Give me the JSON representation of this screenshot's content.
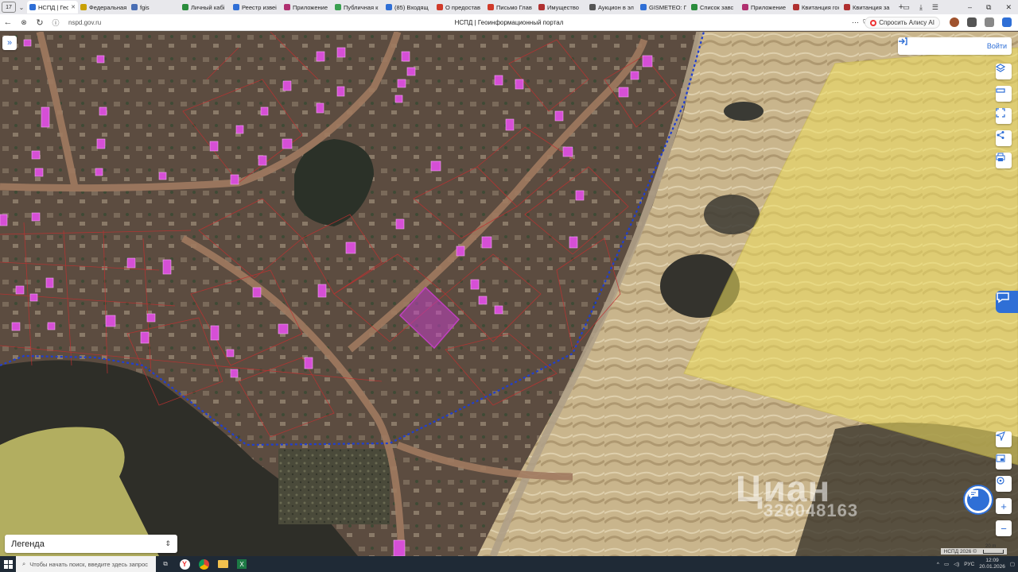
{
  "browser": {
    "tab_count": "17",
    "tabs": [
      {
        "title": "НСПД | Гео",
        "color": "#2f6fd6",
        "active": true
      },
      {
        "title": "Федеральная",
        "color": "#c9a000"
      },
      {
        "title": "fgis",
        "color": "#4a6fb5"
      },
      {
        "title": "Личный кабі",
        "color": "#2a8c3c"
      },
      {
        "title": "Реестр извеі",
        "color": "#2f6fd6"
      },
      {
        "title": "Приложение",
        "color": "#b03070"
      },
      {
        "title": "Публичная к",
        "color": "#3aa050"
      },
      {
        "title": "(85) Входящ",
        "color": "#2f6fd6"
      },
      {
        "title": "О предостав",
        "color": "#d03a2a"
      },
      {
        "title": "Письмо Глав",
        "color": "#d03a2a"
      },
      {
        "title": "Имущество",
        "color": "#b03030"
      },
      {
        "title": "Аукцион в эл",
        "color": "#555555"
      },
      {
        "title": "GISMETEO: П",
        "color": "#2f6fd6"
      },
      {
        "title": "Список завс",
        "color": "#2a8c3c"
      },
      {
        "title": "Приложение",
        "color": "#b03070"
      },
      {
        "title": "Квитанция гос",
        "color": "#b03030"
      },
      {
        "title": "Квитанция за",
        "color": "#b03030"
      }
    ],
    "url": "nspd.gov.ru",
    "page_title": "НСПД | Геоинформационный портал",
    "alisa_label": "Спросить Алису AI"
  },
  "map": {
    "login_label": "Войти",
    "legend_label": "Легенда",
    "watermark_text": "Циан",
    "watermark_number": "326048163",
    "attribution": "НСПД 2026 ©",
    "scale_label": "20 m"
  },
  "taskbar": {
    "search_placeholder": "Чтобы начать поиск, введите здесь запрос",
    "language": "РУС",
    "time": "12:09",
    "date": "20.01.2026"
  },
  "colors": {
    "accent": "#2f6fd6",
    "parcel_highlight": "#c040c0",
    "boundary_blue": "#1f3fd0",
    "zone_yellow": "#f0e060"
  }
}
